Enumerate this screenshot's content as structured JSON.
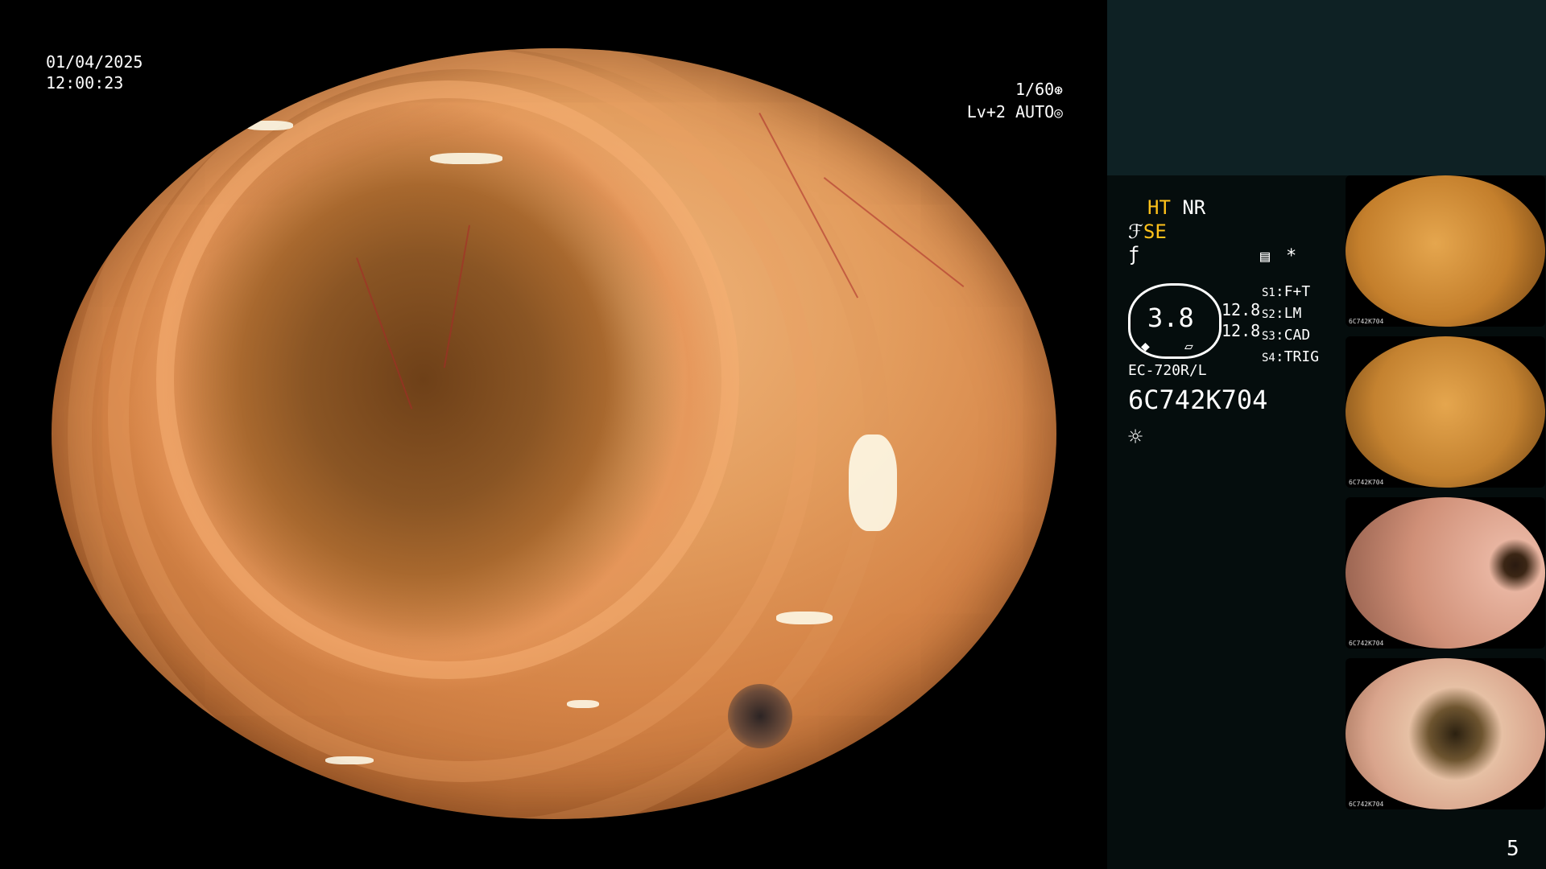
{
  "osd": {
    "date": "01/04/2025",
    "time": "12:00:23",
    "shutter": "1/60",
    "level": "Lv+2",
    "auto": "AUTO"
  },
  "side": {
    "ht": "HT",
    "nr": "NR",
    "se": "SE",
    "star": "*",
    "gauge_value": "3.8",
    "gauge_left_top": "12.8",
    "gauge_left_bottom": "12.8",
    "switches": [
      {
        "key": "S1",
        "val": "F+T"
      },
      {
        "key": "S2",
        "val": "LM"
      },
      {
        "key": "S3",
        "val": "CAD"
      },
      {
        "key": "S4",
        "val": "TRIG"
      }
    ],
    "scope_model": "EC-720R/L",
    "serial": "6C742K704",
    "page_number": "5"
  },
  "thumbnails": [
    {
      "caption": "6C742K704"
    },
    {
      "caption": "6C742K704"
    },
    {
      "caption": "6C742K704"
    },
    {
      "caption": "6C742K704"
    }
  ],
  "icons": {
    "shutter_icon": "shutter-icon",
    "iris_icon": "iris-icon",
    "brightness_icon": "sun-icon",
    "menu_icon": "menu-icon"
  }
}
